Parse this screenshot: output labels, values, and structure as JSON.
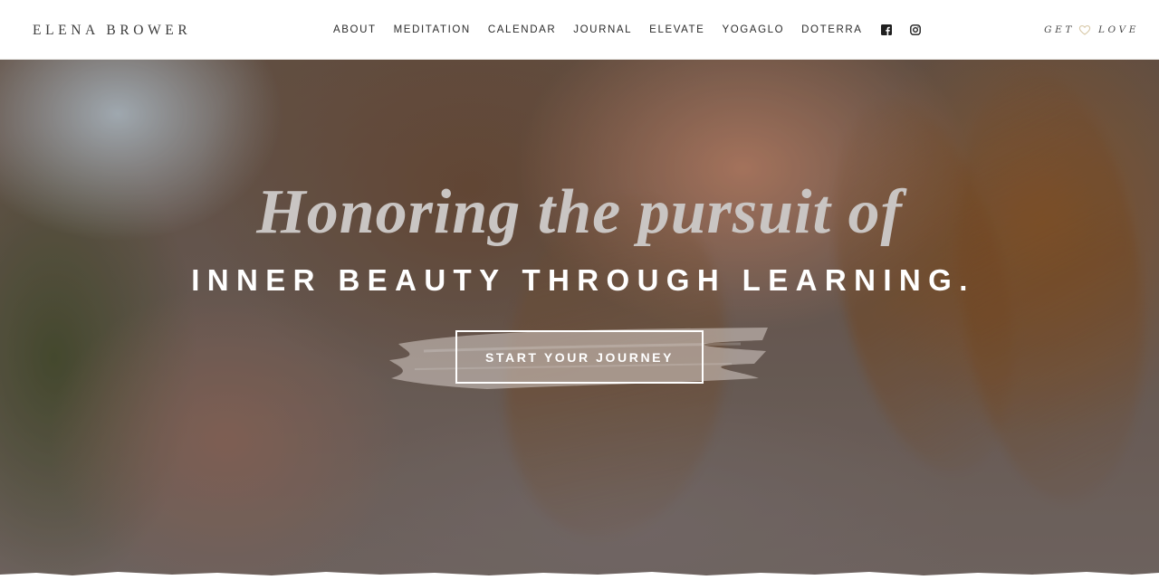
{
  "header": {
    "logo": "ELENA BROWER",
    "nav": [
      {
        "label": "ABOUT"
      },
      {
        "label": "MEDITATION"
      },
      {
        "label": "CALENDAR"
      },
      {
        "label": "JOURNAL"
      },
      {
        "label": "ELEVATE"
      },
      {
        "label": "YOGAGLO"
      },
      {
        "label": "DOTERRA"
      }
    ],
    "social_icons": [
      "facebook-icon",
      "instagram-icon"
    ],
    "get_love": {
      "left": "GET",
      "right": "LOVE",
      "icon": "heart-icon",
      "icon_color": "#d8c9a8"
    }
  },
  "hero": {
    "headline_script": "Honoring the pursuit of",
    "headline_caps": "INNER BEAUTY THROUGH LEARNING.",
    "cta_label": "START YOUR JOURNEY"
  },
  "colors": {
    "text_dark": "#2b2b2b",
    "hero_white": "#ffffff",
    "script_gray": "#c9c5c3"
  }
}
